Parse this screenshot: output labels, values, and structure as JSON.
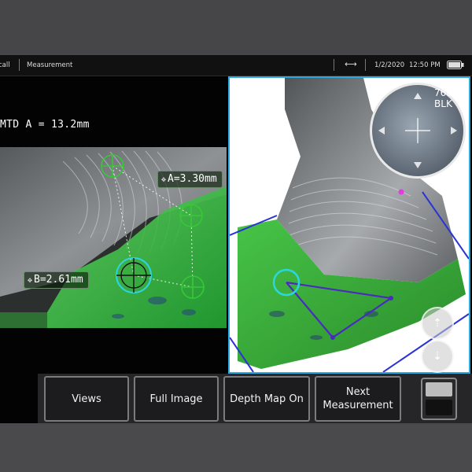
{
  "statusbar": {
    "crumb_left": "call",
    "crumb_section": "Measurement",
    "date": "1/2/2020",
    "time": "12:50 PM",
    "link_icon": "split-arrows-icon",
    "battery_icon": "battery-icon"
  },
  "measurement": {
    "mtd_label": "MTD A = 13.2mm",
    "tag_a": "A=3.30mm",
    "tag_b": "B=2.61mm"
  },
  "magnifier": {
    "zoom_line1": "768",
    "zoom_line2": "BLK"
  },
  "softkeys": {
    "views": "Views",
    "full_image": "Full Image",
    "depth_map": "Depth Map On",
    "next_line1": "Next",
    "next_line2": "Measurement"
  },
  "colors": {
    "accent_border": "#2aa9e0",
    "cursor_green": "#37c837",
    "cursor_cyan": "#2ad6e0",
    "measure_purple": "#4b2bbf",
    "plane_blue": "#2a33d6"
  }
}
